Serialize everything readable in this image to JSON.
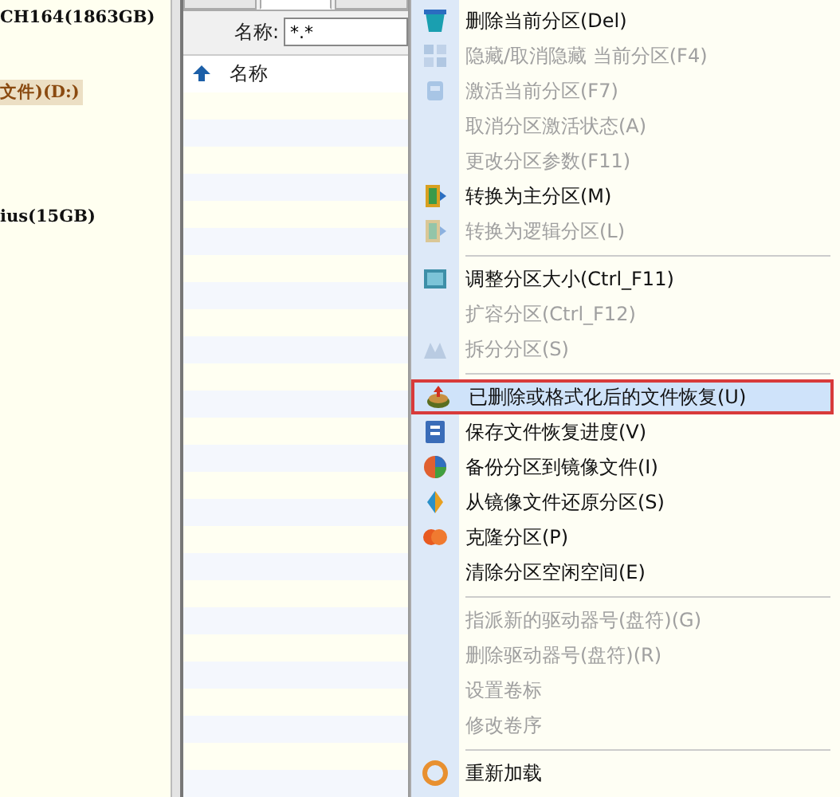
{
  "tree": {
    "items": [
      {
        "label": "CH164(1863GB)",
        "selected": false
      },
      {
        "label": "文件)(D:)",
        "selected": true
      },
      {
        "label": "ius(15GB)",
        "selected": false
      }
    ]
  },
  "panel": {
    "tabs": [
      {
        "selected": false
      },
      {
        "selected": true
      },
      {
        "selected": false
      }
    ],
    "filter": {
      "label": "名称:",
      "value": "*.*"
    },
    "column": {
      "label": "名称"
    }
  },
  "context_menu": {
    "items": [
      {
        "kind": "item",
        "label": "删除当前分区(Del)",
        "disabled": false,
        "highlighted": false
      },
      {
        "kind": "item",
        "label": "隐藏/取消隐藏 当前分区(F4)",
        "disabled": true,
        "highlighted": false
      },
      {
        "kind": "item",
        "label": "激活当前分区(F7)",
        "disabled": true,
        "highlighted": false
      },
      {
        "kind": "item",
        "label": "取消分区激活状态(A)",
        "disabled": true,
        "highlighted": false
      },
      {
        "kind": "item",
        "label": "更改分区参数(F11)",
        "disabled": true,
        "highlighted": false
      },
      {
        "kind": "item",
        "label": "转换为主分区(M)",
        "disabled": false,
        "highlighted": false
      },
      {
        "kind": "item",
        "label": "转换为逻辑分区(L)",
        "disabled": true,
        "highlighted": false
      },
      {
        "kind": "separator"
      },
      {
        "kind": "item",
        "label": "调整分区大小(Ctrl_F11)",
        "disabled": false,
        "highlighted": false
      },
      {
        "kind": "item",
        "label": "扩容分区(Ctrl_F12)",
        "disabled": true,
        "highlighted": false
      },
      {
        "kind": "item",
        "label": "拆分分区(S)",
        "disabled": true,
        "highlighted": false
      },
      {
        "kind": "separator"
      },
      {
        "kind": "item",
        "label": "已删除或格式化后的文件恢复(U)",
        "disabled": false,
        "highlighted": true
      },
      {
        "kind": "item",
        "label": "保存文件恢复进度(V)",
        "disabled": false,
        "highlighted": false
      },
      {
        "kind": "item",
        "label": "备份分区到镜像文件(I)",
        "disabled": false,
        "highlighted": false
      },
      {
        "kind": "item",
        "label": "从镜像文件还原分区(S)",
        "disabled": false,
        "highlighted": false
      },
      {
        "kind": "item",
        "label": "克隆分区(P)",
        "disabled": false,
        "highlighted": false
      },
      {
        "kind": "item",
        "label": "清除分区空闲空间(E)",
        "disabled": false,
        "highlighted": false
      },
      {
        "kind": "separator"
      },
      {
        "kind": "item",
        "label": "指派新的驱动器号(盘符)(G)",
        "disabled": true,
        "highlighted": false
      },
      {
        "kind": "item",
        "label": "删除驱动器号(盘符)(R)",
        "disabled": true,
        "highlighted": false
      },
      {
        "kind": "item",
        "label": "设置卷标",
        "disabled": true,
        "highlighted": false
      },
      {
        "kind": "item",
        "label": "修改卷序",
        "disabled": true,
        "highlighted": false
      },
      {
        "kind": "separator"
      },
      {
        "kind": "item",
        "label": "重新加载",
        "disabled": false,
        "highlighted": false
      }
    ]
  }
}
